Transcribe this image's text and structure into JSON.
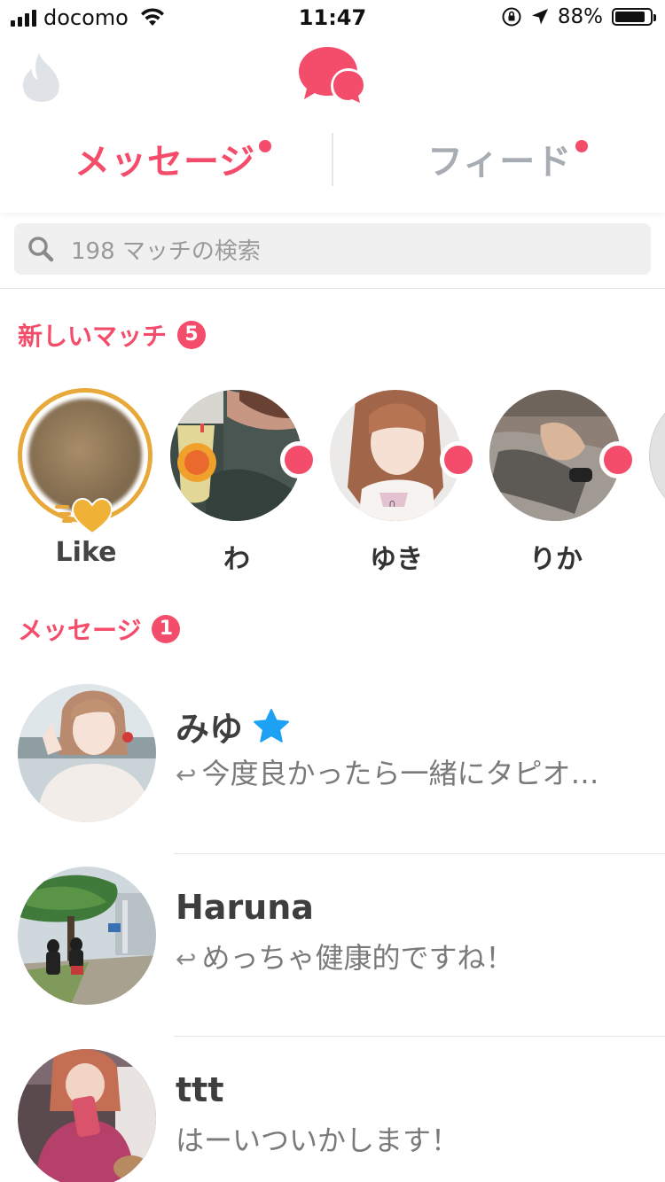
{
  "status_bar": {
    "carrier": "docomo",
    "time": "11:47",
    "battery": "88%",
    "battery_level": 0.88
  },
  "header": {
    "tabs": [
      {
        "label": "メッセージ",
        "active": true,
        "has_dot": true
      },
      {
        "label": "フィード",
        "active": false,
        "has_dot": true
      }
    ]
  },
  "search": {
    "placeholder": "198 マッチの検索"
  },
  "new_matches": {
    "title": "新しいマッチ",
    "count": "5",
    "items": [
      {
        "name": "Like",
        "type": "likes"
      },
      {
        "name": "わ",
        "new": true
      },
      {
        "name": "ゆき",
        "new": true
      },
      {
        "name": "りか",
        "new": true
      }
    ]
  },
  "messages": {
    "title": "メッセージ",
    "count": "1",
    "items": [
      {
        "name": "みゆ",
        "verified": true,
        "preview": "今度良かったら一緒にタピオ…",
        "replied": true
      },
      {
        "name": "Haruna",
        "verified": false,
        "preview": "めっちゃ健康的ですね！",
        "replied": true
      },
      {
        "name": "ttt",
        "verified": false,
        "preview": "はーいついかします！",
        "replied": false
      }
    ]
  },
  "colors": {
    "brand": "#f44d6b",
    "gold": "#e8a93a",
    "inactive": "#a8adb3",
    "star": "#1da1f2"
  }
}
